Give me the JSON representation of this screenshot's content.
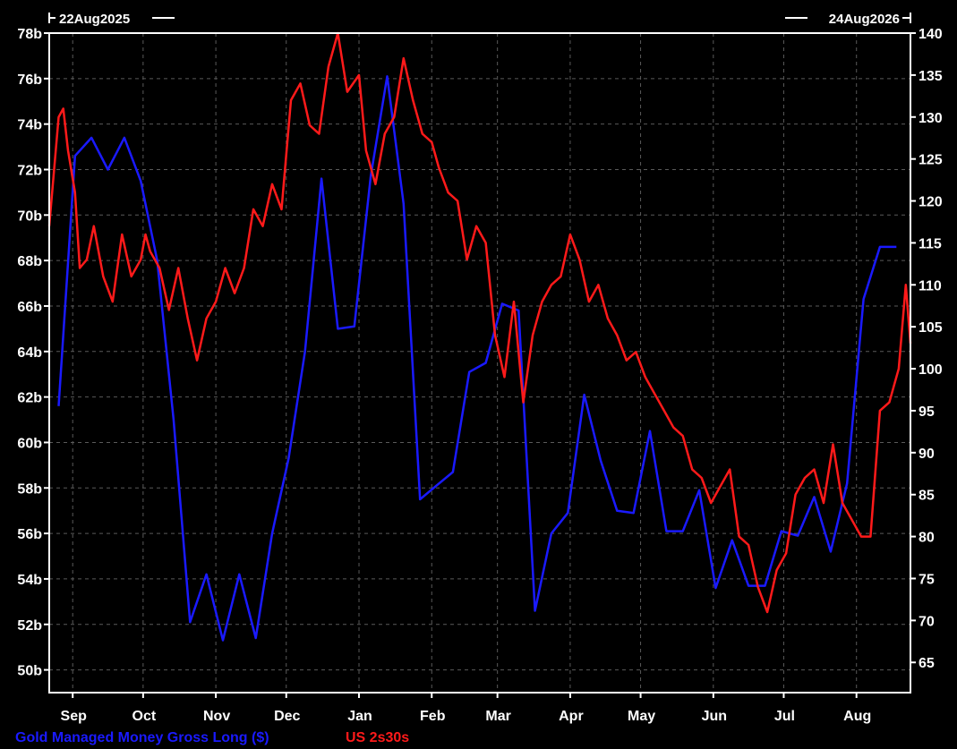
{
  "chart_data": {
    "type": "line",
    "start_date_label": "22Aug2025",
    "end_date_label": "24Aug2026",
    "x_tick_labels": [
      "Sep",
      "Oct",
      "Nov",
      "Dec",
      "Jan",
      "Feb",
      "Mar",
      "Apr",
      "May",
      "Jun",
      "Jul",
      "Aug"
    ],
    "x_tick_dates": [
      "2025-09-01",
      "2025-10-01",
      "2025-11-01",
      "2025-12-01",
      "2026-01-01",
      "2026-02-01",
      "2026-03-01",
      "2026-04-01",
      "2026-05-01",
      "2026-06-01",
      "2026-07-01",
      "2026-08-01"
    ],
    "x_range": [
      "2025-08-22",
      "2026-08-24"
    ],
    "left_axis": {
      "ylim": [
        49,
        78
      ],
      "ticks": [
        50,
        52,
        54,
        56,
        58,
        60,
        62,
        64,
        66,
        68,
        70,
        72,
        74,
        76,
        78
      ],
      "tick_labels": [
        "50b",
        "52b",
        "54b",
        "56b",
        "58b",
        "60b",
        "62b",
        "64b",
        "66b",
        "68b",
        "70b",
        "72b",
        "74b",
        "76b",
        "78b"
      ]
    },
    "right_axis": {
      "ylim": [
        61.4,
        140
      ],
      "ticks": [
        65,
        70,
        75,
        80,
        85,
        90,
        95,
        100,
        105,
        110,
        115,
        120,
        125,
        130,
        135,
        140
      ],
      "tick_labels": [
        "65",
        "70",
        "75",
        "80",
        "85",
        "90",
        "95",
        "100",
        "105",
        "110",
        "115",
        "120",
        "125",
        "130",
        "135",
        "140"
      ]
    },
    "grid": true,
    "legend_position": "bottom-left",
    "series": [
      {
        "name": "Gold Managed Money Gross Long ($)",
        "axis": "left",
        "color": "#1a1aff",
        "x": [
          "2025-08-26",
          "2025-09-02",
          "2025-09-09",
          "2025-09-16",
          "2025-09-23",
          "2025-09-30",
          "2025-10-07",
          "2025-10-14",
          "2025-10-21",
          "2025-10-28",
          "2025-11-04",
          "2025-11-11",
          "2025-11-18",
          "2025-11-25",
          "2025-12-02",
          "2025-12-09",
          "2025-12-16",
          "2025-12-23",
          "2025-12-30",
          "2026-01-06",
          "2026-01-13",
          "2026-01-20",
          "2026-01-27",
          "2026-02-03",
          "2026-02-10",
          "2026-02-17",
          "2026-02-24",
          "2026-03-03",
          "2026-03-10",
          "2026-03-17",
          "2026-03-24",
          "2026-03-31",
          "2026-04-07",
          "2026-04-14",
          "2026-04-21",
          "2026-04-28",
          "2026-05-05",
          "2026-05-12",
          "2026-05-19",
          "2026-05-26",
          "2026-06-02",
          "2026-06-09",
          "2026-06-16",
          "2026-06-23",
          "2026-06-30",
          "2026-07-07",
          "2026-07-14",
          "2026-07-21",
          "2026-07-28",
          "2026-08-04",
          "2026-08-11",
          "2026-08-18"
        ],
        "values": [
          61.6,
          72.6,
          73.4,
          72.0,
          73.4,
          71.5,
          68.0,
          61.0,
          52.1,
          54.2,
          51.3,
          54.2,
          51.4,
          56.0,
          59.3,
          64.0,
          71.6,
          65.0,
          65.1,
          71.7,
          76.1,
          70.5,
          57.5,
          58.1,
          58.7,
          63.1,
          63.5,
          66.1,
          65.8,
          52.6,
          56.0,
          56.9,
          62.1,
          59.2,
          57.0,
          56.9,
          60.5,
          56.1,
          56.1,
          57.9,
          53.6,
          55.7,
          53.7,
          53.7,
          56.1,
          55.9,
          57.6,
          55.2,
          58.2,
          66.3,
          68.6,
          68.6
        ]
      },
      {
        "name": "US 2s30s",
        "axis": "right",
        "color": "#ff1a1a",
        "x": [
          "2025-08-22",
          "2025-08-26",
          "2025-08-28",
          "2025-08-30",
          "2025-09-02",
          "2025-09-04",
          "2025-09-07",
          "2025-09-10",
          "2025-09-14",
          "2025-09-18",
          "2025-09-22",
          "2025-09-26",
          "2025-09-30",
          "2025-10-02",
          "2025-10-04",
          "2025-10-08",
          "2025-10-12",
          "2025-10-16",
          "2025-10-20",
          "2025-10-24",
          "2025-10-28",
          "2025-11-01",
          "2025-11-05",
          "2025-11-09",
          "2025-11-13",
          "2025-11-17",
          "2025-11-21",
          "2025-11-25",
          "2025-11-29",
          "2025-12-03",
          "2025-12-07",
          "2025-12-11",
          "2025-12-15",
          "2025-12-19",
          "2025-12-23",
          "2025-12-27",
          "2026-01-01",
          "2026-01-04",
          "2026-01-08",
          "2026-01-12",
          "2026-01-16",
          "2026-01-20",
          "2026-01-24",
          "2026-01-28",
          "2026-02-01",
          "2026-02-04",
          "2026-02-08",
          "2026-02-12",
          "2026-02-16",
          "2026-02-20",
          "2026-02-24",
          "2026-02-28",
          "2026-03-04",
          "2026-03-08",
          "2026-03-12",
          "2026-03-16",
          "2026-03-20",
          "2026-03-24",
          "2026-03-28",
          "2026-04-01",
          "2026-04-05",
          "2026-04-09",
          "2026-04-13",
          "2026-04-17",
          "2026-04-21",
          "2026-04-25",
          "2026-04-29",
          "2026-05-03",
          "2026-05-07",
          "2026-05-11",
          "2026-05-15",
          "2026-05-19",
          "2026-05-23",
          "2026-05-27",
          "2026-05-31",
          "2026-06-04",
          "2026-06-08",
          "2026-06-12",
          "2026-06-16",
          "2026-06-20",
          "2026-06-24",
          "2026-06-28",
          "2026-07-02",
          "2026-07-06",
          "2026-07-10",
          "2026-07-14",
          "2026-07-18",
          "2026-07-22",
          "2026-07-26",
          "2026-07-30",
          "2026-08-03",
          "2026-08-07",
          "2026-08-11",
          "2026-08-15",
          "2026-08-19",
          "2026-08-22",
          "2026-08-24"
        ],
        "values": [
          117,
          130,
          131,
          126,
          121,
          112,
          113,
          117,
          111,
          108,
          116,
          111,
          113,
          116,
          114,
          112,
          107,
          112,
          106,
          101,
          106,
          108,
          112,
          109,
          112,
          119,
          117,
          122,
          119,
          132,
          134,
          129,
          128,
          136,
          140,
          133,
          135,
          126,
          122,
          128,
          130,
          137,
          132,
          128,
          127,
          124,
          121,
          120,
          113,
          117,
          115,
          104,
          99,
          108,
          96,
          104,
          108,
          110,
          111,
          116,
          113,
          108,
          110,
          106,
          104,
          101,
          102,
          99,
          97,
          95,
          93,
          92,
          88,
          87,
          84,
          86,
          88,
          80,
          79,
          74,
          71,
          76,
          78,
          85,
          87,
          88,
          84,
          91,
          84,
          82,
          80,
          80,
          95,
          96,
          100,
          110,
          103
        ]
      }
    ]
  }
}
